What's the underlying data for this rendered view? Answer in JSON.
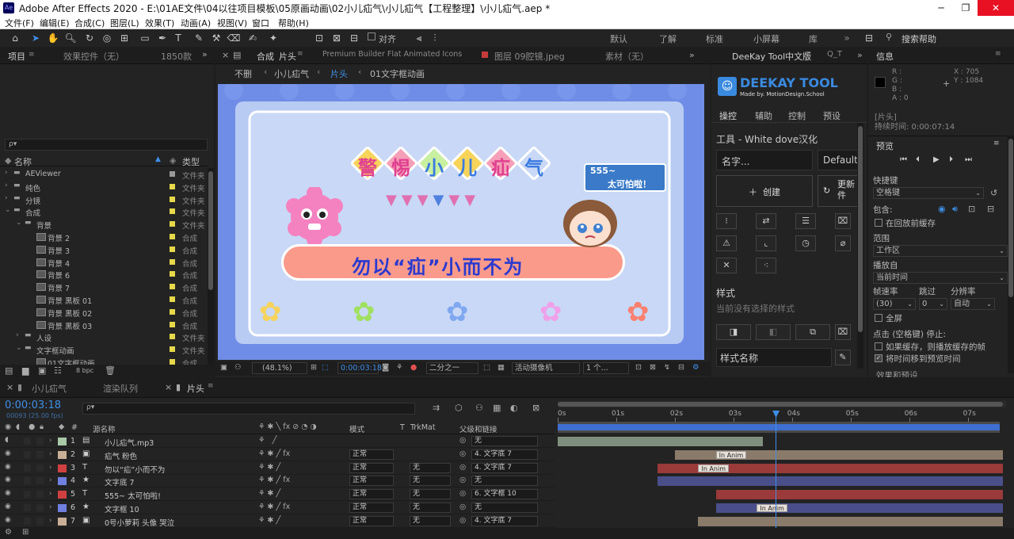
{
  "window": {
    "title": "Adobe After Effects 2020 - E:\\01AE文件\\04以往项目模板\\05原画动画\\02小儿疝气\\小儿疝气【工程整理】\\小儿疝气.aep *",
    "min": "─",
    "max": "❐",
    "close": "✕"
  },
  "menu": [
    "文件(F)",
    "编辑(E)",
    "合成(C)",
    "图层(L)",
    "效果(T)",
    "动画(A)",
    "视图(V)",
    "窗口",
    "帮助(H)"
  ],
  "toolbar": {
    "align_label": "对齐",
    "workspaces": [
      "默认",
      "了解",
      "标准",
      "小屏幕",
      "库"
    ],
    "search_placeholder": "搜索帮助"
  },
  "project": {
    "tabs": [
      "项目",
      "效果控件（无）",
      "1850款"
    ],
    "search": "ρ▾",
    "col_name": "名称",
    "col_type": "类型",
    "bpc": "8 bpc",
    "items": [
      {
        "name": "AEViewer",
        "type": "文件夹",
        "indent": 0,
        "kind": "folder",
        "color": "#9a9a9a",
        "open": false
      },
      {
        "name": "纯色",
        "type": "文件夹",
        "indent": 0,
        "kind": "folder",
        "color": "#e6d84a",
        "open": false
      },
      {
        "name": "分镜",
        "type": "文件夹",
        "indent": 0,
        "kind": "folder",
        "color": "#e6d84a",
        "open": false
      },
      {
        "name": "合成",
        "type": "文件夹",
        "indent": 0,
        "kind": "folder",
        "color": "#e6d84a",
        "open": true
      },
      {
        "name": "背景",
        "type": "文件夹",
        "indent": 1,
        "kind": "folder",
        "color": "#e6d84a",
        "open": true
      },
      {
        "name": "背景 2",
        "type": "合成",
        "indent": 2,
        "kind": "comp",
        "color": "#e6d84a"
      },
      {
        "name": "背景 3",
        "type": "合成",
        "indent": 2,
        "kind": "comp",
        "color": "#e6d84a"
      },
      {
        "name": "背景 4",
        "type": "合成",
        "indent": 2,
        "kind": "comp",
        "color": "#e6d84a"
      },
      {
        "name": "背景 6",
        "type": "合成",
        "indent": 2,
        "kind": "comp",
        "color": "#e6d84a"
      },
      {
        "name": "背景 7",
        "type": "合成",
        "indent": 2,
        "kind": "comp",
        "color": "#e6d84a"
      },
      {
        "name": "背景 黑板 01",
        "type": "合成",
        "indent": 2,
        "kind": "comp",
        "color": "#e6d84a"
      },
      {
        "name": "背景 黑板 02",
        "type": "合成",
        "indent": 2,
        "kind": "comp",
        "color": "#e6d84a"
      },
      {
        "name": "背景 黑板 03",
        "type": "合成",
        "indent": 2,
        "kind": "comp",
        "color": "#e6d84a"
      },
      {
        "name": "人设",
        "type": "文件夹",
        "indent": 1,
        "kind": "folder",
        "color": "#e6d84a",
        "open": false
      },
      {
        "name": "文字框动画",
        "type": "文件夹",
        "indent": 1,
        "kind": "folder",
        "color": "#e6d84a",
        "open": true
      },
      {
        "name": "01文字框动画",
        "type": "合成",
        "indent": 2,
        "kind": "comp",
        "color": "#e6d84a"
      }
    ]
  },
  "comp": {
    "tabs": [
      "合成",
      "片头",
      "Premium Builder Flat Animated Icons",
      "图层 09腔镜.jpeg",
      "素材（无）"
    ],
    "breadcrumbs": [
      "不删",
      "小儿疝气",
      "片头",
      "01文字框动画"
    ],
    "zoom": "(48.1%)",
    "timecode": "0:00:03:18",
    "resolution": "二分之一",
    "camera": "活动摄像机",
    "views": "1 个...",
    "art": {
      "title_chars": [
        "警",
        "惕",
        "小",
        "儿",
        "疝",
        "气"
      ],
      "bubble_num": "555~",
      "bubble_text": "太可怕啦！",
      "banner": "勿以“疝”小而不为"
    }
  },
  "deekay": {
    "tab": "DeeKay Tool中文版",
    "tab2": "Q_T",
    "logo": "DEEKAY TOOL",
    "logo_sub": "Made by. MotionDesign.School",
    "nav": [
      "操控",
      "辅助",
      "控制",
      "预设"
    ],
    "tool_label": "工具 - White dove汉化",
    "name_placeholder": "名字...",
    "default_btn": "Default",
    "create_btn": "创建",
    "update_btn": "更新件",
    "style_label": "样式",
    "style_hint": "当前没有选择的样式",
    "style_name": "样式名称"
  },
  "info": {
    "tab": "信息",
    "rgb": [
      "R :",
      "G :",
      "B :",
      "A : 0"
    ],
    "x": "X : 705",
    "y": "Y : 1084",
    "layer_name": "[片头]",
    "duration": "持续时间: 0:00:07:14",
    "preview_tab": "预览",
    "shortcut_label": "快捷键",
    "shortcut_value": "空格键",
    "include_label": "包含:",
    "cache_label": "在回放前缓存",
    "range_label": "范围",
    "range_value": "工作区",
    "play_from_label": "播放自",
    "play_from_value": "当前时间",
    "fps_label": "帧速率",
    "skip_label": "跳过",
    "res_label": "分辨率",
    "fps_value": "(30)",
    "skip_value": "0",
    "res_value": "自动",
    "fullscreen": "全屏",
    "stop_hint": "点击 (空格键) 停止:",
    "opt1": "如果缓存，则播放缓存的帧",
    "opt2": "将时间移到预览时间",
    "effects_tab": "效果和预设"
  },
  "timeline": {
    "tabs": [
      "小儿疝气",
      "渲染队列",
      "片头"
    ],
    "timecode": "0:00:03:18",
    "frame_info": "00093 (25.00 fps)",
    "search": "ρ▾",
    "headers": {
      "num": "#",
      "name": "源名称",
      "mode": "模式",
      "t": "T",
      "trkmat": "TrkMat",
      "parent": "父级和链接"
    },
    "ruler": [
      "0s",
      "01s",
      "02s",
      "03s",
      "04s",
      "05s",
      "06s",
      "07s"
    ],
    "layers": [
      {
        "num": "1",
        "kind": "file",
        "label_color": "#a8c8a8",
        "name": "小儿疝气.mp3",
        "mode": "",
        "trk": "",
        "parent": "无",
        "bar_color": "#7f8f7f",
        "bar_start": 0,
        "bar_end": 3.5,
        "anim": ""
      },
      {
        "num": "2",
        "kind": "comp",
        "label_color": "#c8b098",
        "name": "疝气 粉色",
        "mode": "正常",
        "trk": "",
        "parent": "4. 文字底 7",
        "bar_color": "#8a7a6a",
        "bar_start": 2.0,
        "bar_end": 7.6,
        "anim": "In Anim",
        "anim_at": 2.7
      },
      {
        "num": "3",
        "kind": "text",
        "label_color": "#d04040",
        "name": "勿以“疝”小而不为",
        "mode": "正常",
        "trk": "无",
        "parent": "4. 文字底 7",
        "bar_color": "#9a3a3a",
        "bar_start": 1.7,
        "bar_end": 7.6,
        "anim": "In Anim",
        "anim_at": 2.4
      },
      {
        "num": "4",
        "kind": "shape",
        "label_color": "#7080e0",
        "name": "文字底 7",
        "mode": "正常",
        "trk": "无",
        "parent": "无",
        "bar_color": "#4a4f8a",
        "bar_start": 1.7,
        "bar_end": 7.6,
        "anim": ""
      },
      {
        "num": "5",
        "kind": "text",
        "label_color": "#d04040",
        "name": "555~    太可怕啦!",
        "mode": "正常",
        "trk": "无",
        "parent": "6. 文字框 10",
        "bar_color": "#9a3a3a",
        "bar_start": 2.7,
        "bar_end": 7.6,
        "anim": ""
      },
      {
        "num": "6",
        "kind": "shape",
        "label_color": "#7080e0",
        "name": "文字框 10",
        "mode": "正常",
        "trk": "无",
        "parent": "无",
        "bar_color": "#4a4f8a",
        "bar_start": 2.7,
        "bar_end": 7.6,
        "anim": "In Anim",
        "anim_at": 3.4
      },
      {
        "num": "7",
        "kind": "comp",
        "label_color": "#c8b098",
        "name": "0号小萝莉 头像 哭泣",
        "mode": "正常",
        "trk": "无",
        "parent": "4. 文字底 7",
        "bar_color": "#8a7a6a",
        "bar_start": 2.4,
        "bar_end": 7.6,
        "anim": ""
      }
    ],
    "playhead": 3.72,
    "duration": 7.6
  }
}
